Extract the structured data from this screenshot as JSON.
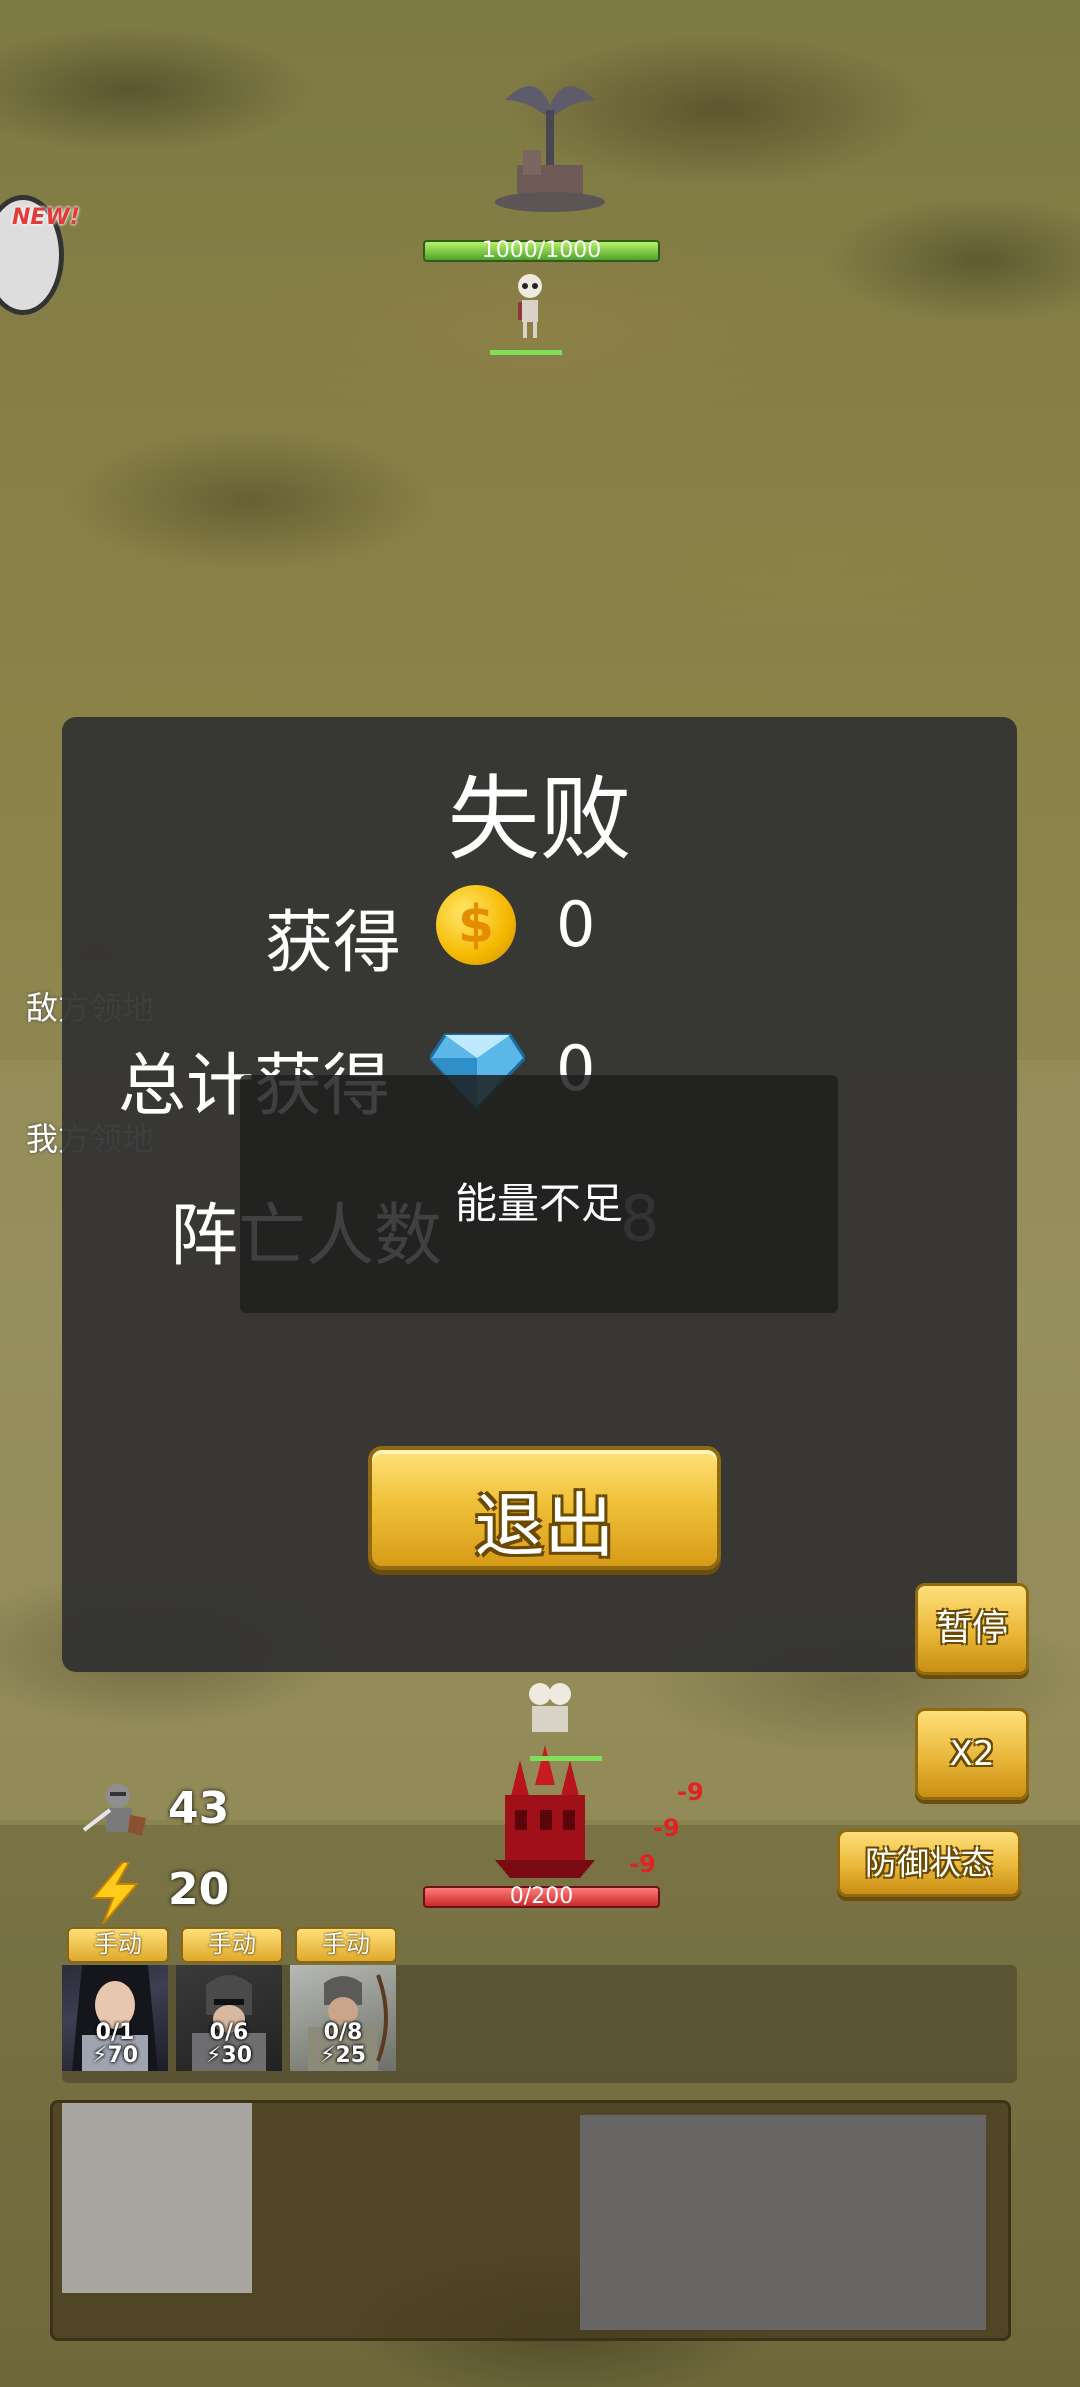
{
  "enemy": {
    "hp_text": "1000/1000",
    "hp_fraction": 1.0
  },
  "new_badge": "NEW!",
  "territory": {
    "enemy_label": "敌方领地",
    "player_label": "我方领地"
  },
  "result_panel": {
    "title": "失败",
    "earned_label": "获得",
    "earned_value": "0",
    "total_label": "总计获得",
    "total_value": "0",
    "deaths_label": "阵亡人数",
    "deaths_value": "8",
    "exit_label": "退出"
  },
  "toast": {
    "text": "能量不足"
  },
  "side_buttons": {
    "pause": "暂停",
    "speed": "X2",
    "defense": "防御状态"
  },
  "player": {
    "hp_text": "0/200",
    "hp_fraction": 0.0,
    "damage_numbers": [
      "-9",
      "-9",
      "-9"
    ]
  },
  "resources": {
    "soldiers": "43",
    "energy": "20"
  },
  "units": [
    {
      "tag": "手动",
      "count": "0/1",
      "cost": "70",
      "portrait": "female-knight-portrait"
    },
    {
      "tag": "手动",
      "count": "0/6",
      "cost": "30",
      "portrait": "armored-soldier-portrait"
    },
    {
      "tag": "手动",
      "count": "0/8",
      "cost": "25",
      "portrait": "archer-portrait"
    }
  ],
  "colors": {
    "accent_gold": "#f0c13a",
    "hp_green": "#4fa42a",
    "hp_red": "#c92b2b",
    "damage_red": "#e02222"
  }
}
